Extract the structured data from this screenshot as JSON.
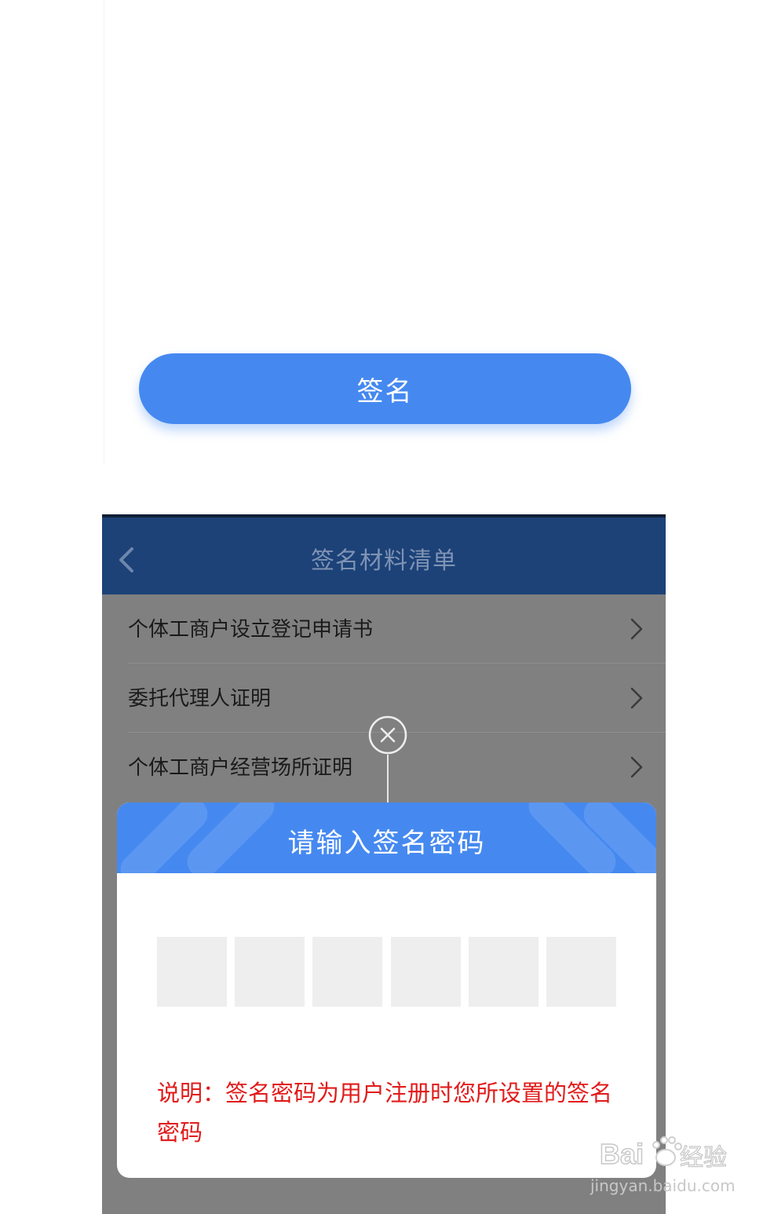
{
  "top": {
    "sign_button_label": "签名"
  },
  "navbar": {
    "title": "签名材料清单",
    "back_icon": "chevron-left-icon"
  },
  "list": {
    "items": [
      {
        "label": "个体工商户设立登记申请书"
      },
      {
        "label": "委托代理人证明"
      },
      {
        "label": "个体工商户经营场所证明"
      }
    ]
  },
  "dialog": {
    "title": "请输入签名密码",
    "close_icon": "close-circle-icon",
    "pin_length": 6,
    "note": "说明：签名密码为用户注册时您所设置的签名密码"
  },
  "watermark": {
    "logo_text": "Baidu经验",
    "url": "jingyan.baidu.com"
  },
  "colors": {
    "primary_blue": "#4589f0",
    "navbar_blue": "#1c4278",
    "overlay_gray": "#808080",
    "note_red": "#e21b1b"
  }
}
